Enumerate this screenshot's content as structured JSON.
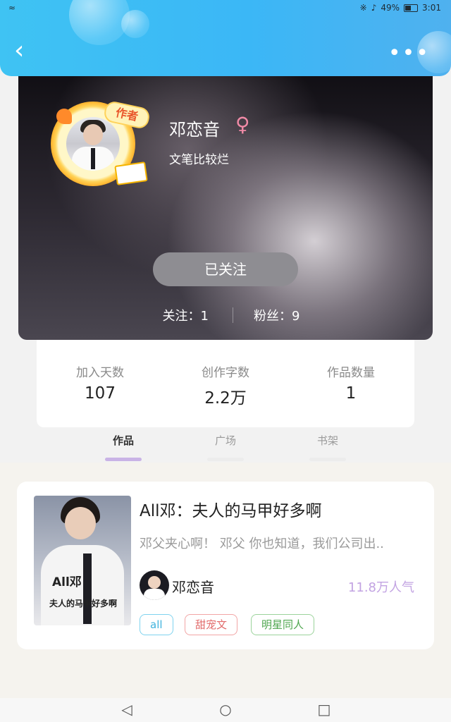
{
  "status_bar": {
    "battery": "49%",
    "time": "3:01"
  },
  "header": {
    "back_icon": "chevron-left-icon",
    "more_icon": "more-dots-icon"
  },
  "profile": {
    "avatar_badge": "作者",
    "name": "邓恋音",
    "gender_symbol": "♀",
    "bio": "文笔比较烂",
    "follow_button": "已关注",
    "following_text": "关注：1",
    "fans_text": "粉丝：9"
  },
  "stats": [
    {
      "label": "加入天数",
      "value": "107"
    },
    {
      "label": "创作字数",
      "value": "2.2万"
    },
    {
      "label": "作品数量",
      "value": "1"
    }
  ],
  "tabs": [
    {
      "label": "作品",
      "active": true
    },
    {
      "label": "广场",
      "active": false
    },
    {
      "label": "书架",
      "active": false
    }
  ],
  "works": [
    {
      "cover_text_line1": "All邓",
      "cover_text_line2": "夫人的马甲好多啊",
      "title": "All邓：夫人的马甲好多啊",
      "excerpt": "邓父夹心啊！ 邓父 你也知道，我们公司出..",
      "author": "邓恋音",
      "popularity": "11.8万人气",
      "tags": [
        "all",
        "甜宠文",
        "明星同人"
      ]
    }
  ],
  "colors": {
    "header_blue": "#3bb7f6",
    "gender_pink": "#f08aa6",
    "popularity_purple": "#c2a3e2",
    "active_tab_bar": "#c9b3e6"
  }
}
